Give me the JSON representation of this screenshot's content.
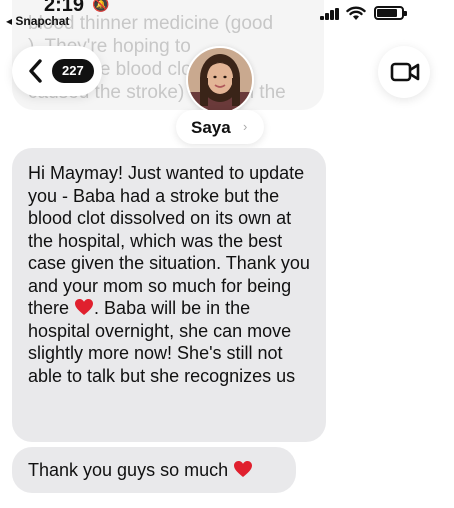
{
  "status_bar": {
    "time": "2:19",
    "back_app": "◂ Snapchat"
  },
  "previous_message": {
    "lines": [
      "blood thinner medicine (good",
      "). They're hoping to",
      "locate the blood clot (that",
      "caused the stroke) through the",
      "... ..."
    ]
  },
  "header": {
    "back_count": "227",
    "contact_name": "Saya",
    "contact_chevron": "›",
    "icons": {
      "back": "chevron-left-icon",
      "video": "video-camera-icon",
      "avatar": "profile-photo"
    }
  },
  "messages": [
    {
      "text": "Hi Maymay! Just wanted to update you - Baba had a stroke but the blood clot dissolved on its own at the hospital, which was the best case given the situation. Thank you and your mom so much for being there",
      "text_after_heart": ". Baba will be in the hospital overnight, she can move slightly more now! She's still not able to talk but she recognizes us"
    },
    {
      "text": "Thank you guys so much"
    }
  ],
  "colors": {
    "bubble": "#e9e9eb",
    "heart": "#e0202e",
    "badge": "#111111"
  }
}
